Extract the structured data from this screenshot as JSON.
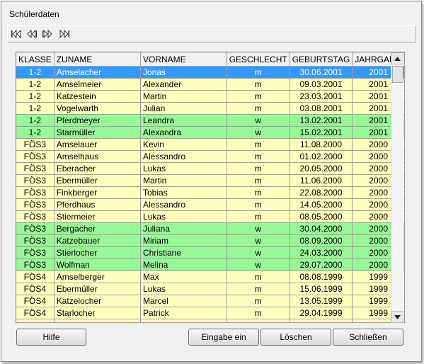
{
  "window": {
    "title": "Schülerdaten"
  },
  "navigation": {
    "first_icon": "first-record-icon",
    "prev_icon": "previous-record-icon",
    "next_icon": "next-record-icon",
    "last_icon": "last-record-icon"
  },
  "grid": {
    "columns": [
      "KLASSE",
      "ZUNAME",
      "VORNAME",
      "GESCHLECHT",
      "GEBURTSTAG",
      "JAHRGANG"
    ],
    "rows": [
      {
        "klasse": "1-2",
        "zuname": "Amselacher",
        "vorname": "Jonas",
        "geschlecht": "m",
        "geburtstag": "30.06.2001",
        "jahrgang": "2001",
        "color": "selected"
      },
      {
        "klasse": "1-2",
        "zuname": "Amselmeier",
        "vorname": "Alexander",
        "geschlecht": "m",
        "geburtstag": "09.03.2001",
        "jahrgang": "2001",
        "color": "yellow"
      },
      {
        "klasse": "1-2",
        "zuname": "Katzestein",
        "vorname": "Martin",
        "geschlecht": "m",
        "geburtstag": "23.03.2001",
        "jahrgang": "2001",
        "color": "yellow"
      },
      {
        "klasse": "1-2",
        "zuname": "Vogelwarth",
        "vorname": "Julian",
        "geschlecht": "m",
        "geburtstag": "03.08.2001",
        "jahrgang": "2001",
        "color": "yellow"
      },
      {
        "klasse": "1-2",
        "zuname": "Pferdmeyer",
        "vorname": "Leandra",
        "geschlecht": "w",
        "geburtstag": "13.02.2001",
        "jahrgang": "2001",
        "color": "green"
      },
      {
        "klasse": "1-2",
        "zuname": "Starmüller",
        "vorname": "Alexandra",
        "geschlecht": "w",
        "geburtstag": "15.02.2001",
        "jahrgang": "2001",
        "color": "green"
      },
      {
        "klasse": "FÖS3",
        "zuname": "Amselauer",
        "vorname": "Kevin",
        "geschlecht": "m",
        "geburtstag": "11.08.2000",
        "jahrgang": "2000",
        "color": "yellow"
      },
      {
        "klasse": "FÖS3",
        "zuname": "Amselhaus",
        "vorname": "Alessandro",
        "geschlecht": "m",
        "geburtstag": "01.02.2000",
        "jahrgang": "2000",
        "color": "yellow"
      },
      {
        "klasse": "FÖS3",
        "zuname": "Eberacher",
        "vorname": "Lukas",
        "geschlecht": "m",
        "geburtstag": "20.05.2000",
        "jahrgang": "2000",
        "color": "yellow"
      },
      {
        "klasse": "FÖS3",
        "zuname": "Ebermüller",
        "vorname": "Martin",
        "geschlecht": "m",
        "geburtstag": "11.06.2000",
        "jahrgang": "2000",
        "color": "yellow"
      },
      {
        "klasse": "FÖS3",
        "zuname": "Finkberger",
        "vorname": "Tobias",
        "geschlecht": "m",
        "geburtstag": "22.08.2000",
        "jahrgang": "2000",
        "color": "yellow"
      },
      {
        "klasse": "FÖS3",
        "zuname": "Pferdhaus",
        "vorname": "Alessandro",
        "geschlecht": "m",
        "geburtstag": "14.05.2000",
        "jahrgang": "2000",
        "color": "yellow"
      },
      {
        "klasse": "FÖS3",
        "zuname": "Stiermeier",
        "vorname": "Lukas",
        "geschlecht": "m",
        "geburtstag": "08.05.2000",
        "jahrgang": "2000",
        "color": "yellow"
      },
      {
        "klasse": "FÖS3",
        "zuname": "Bergacher",
        "vorname": "Juliana",
        "geschlecht": "w",
        "geburtstag": "30.04.2000",
        "jahrgang": "2000",
        "color": "green"
      },
      {
        "klasse": "FÖS3",
        "zuname": "Katzebauer",
        "vorname": "Miriam",
        "geschlecht": "w",
        "geburtstag": "08.09.2000",
        "jahrgang": "2000",
        "color": "green"
      },
      {
        "klasse": "FÖS3",
        "zuname": "Stierlocher",
        "vorname": "Christiane",
        "geschlecht": "w",
        "geburtstag": "24.03.2000",
        "jahrgang": "2000",
        "color": "green"
      },
      {
        "klasse": "FÖS3",
        "zuname": "Wolfman",
        "vorname": "Melina",
        "geschlecht": "w",
        "geburtstag": "29.07.2000",
        "jahrgang": "2000",
        "color": "green"
      },
      {
        "klasse": "FÖS4",
        "zuname": "Amselberger",
        "vorname": "Max",
        "geschlecht": "m",
        "geburtstag": "08.08.1999",
        "jahrgang": "1999",
        "color": "yellow"
      },
      {
        "klasse": "FÖS4",
        "zuname": "Ebermüller",
        "vorname": "Lukas",
        "geschlecht": "m",
        "geburtstag": "15.06.1999",
        "jahrgang": "1999",
        "color": "yellow"
      },
      {
        "klasse": "FÖS4",
        "zuname": "Katzelocher",
        "vorname": "Marcel",
        "geschlecht": "m",
        "geburtstag": "13.05.1999",
        "jahrgang": "1999",
        "color": "yellow"
      },
      {
        "klasse": "FÖS4",
        "zuname": "Starlocher",
        "vorname": "Patrick",
        "geschlecht": "m",
        "geburtstag": "29.04.1999",
        "jahrgang": "1999",
        "color": "yellow"
      }
    ]
  },
  "colors": {
    "selected": "#3399ff",
    "yellow": "#ffffc0",
    "green": "#98f898"
  },
  "buttons": {
    "hilfe": "Hilfe",
    "eingabe": "Eingabe ein",
    "loeschen": "Löschen",
    "schliessen": "Schließen"
  }
}
